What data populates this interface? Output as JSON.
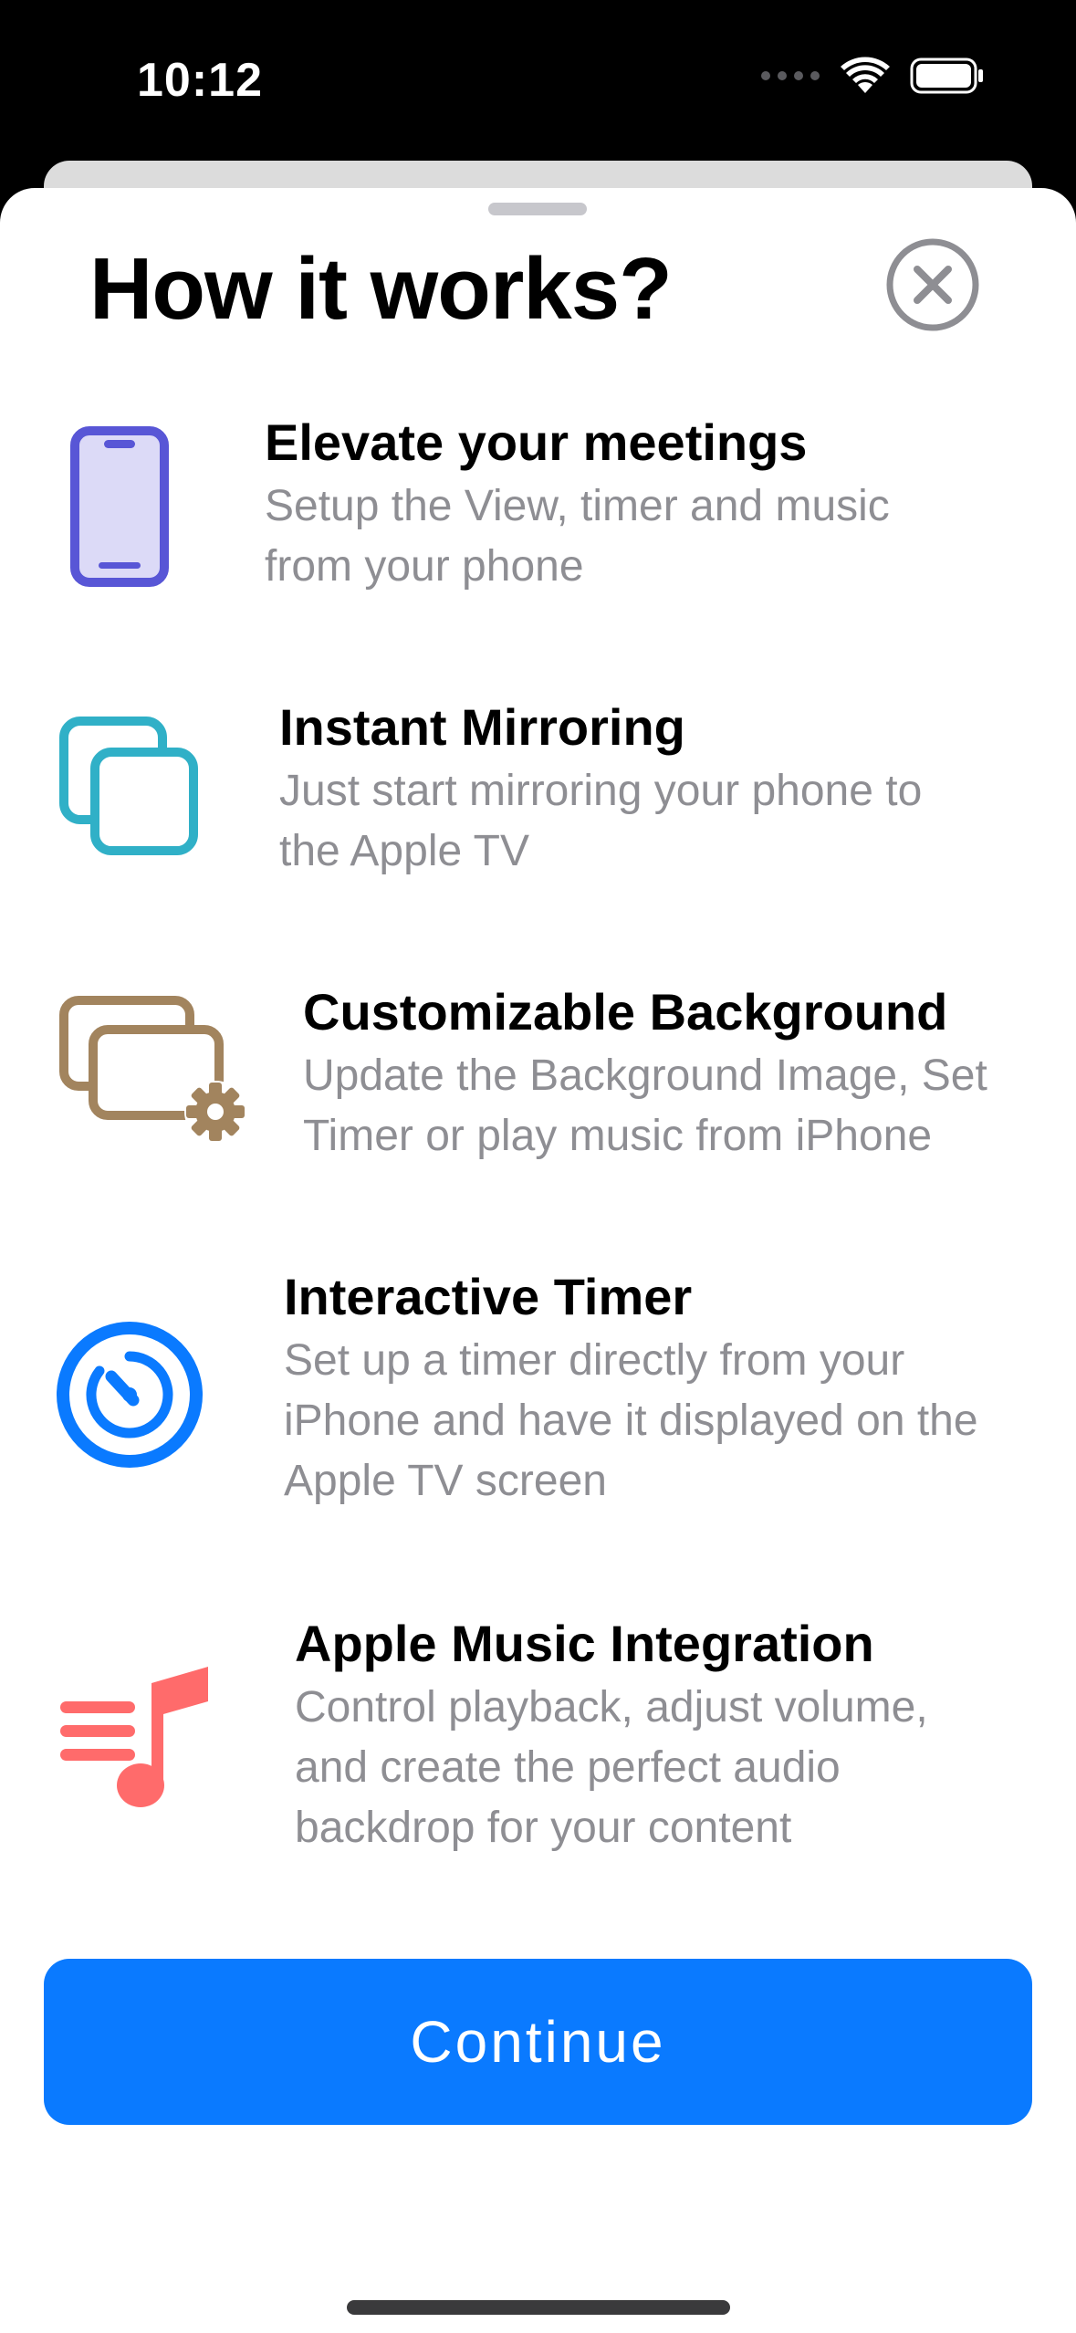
{
  "status_bar": {
    "time": "10:12",
    "icons": [
      "signal-dots-icon",
      "wifi-icon",
      "battery-icon"
    ]
  },
  "sheet": {
    "title": "How it works?",
    "close_icon": "close-circle-icon"
  },
  "features": [
    {
      "icon": "phone-icon",
      "icon_color": "#5856d6",
      "title": "Elevate your meetings",
      "desc_lines": [
        "Setup the View, timer and music",
        "from your phone"
      ]
    },
    {
      "icon": "mirroring-icon",
      "icon_color": "#30b0c7",
      "title": "Instant Mirroring",
      "desc_lines": [
        "Just start mirroring your phone to",
        "the Apple TV"
      ]
    },
    {
      "icon": "background-settings-icon",
      "icon_color": "#a2845e",
      "title": "Customizable Background",
      "desc_lines": [
        "Update the Background Image, Set",
        "Timer or play music from iPhone"
      ]
    },
    {
      "icon": "timer-icon",
      "icon_color": "#0a7aff",
      "title": "Interactive Timer",
      "desc_lines": [
        "Set up a timer directly from your",
        "iPhone and have it displayed on the",
        "Apple TV screen"
      ]
    },
    {
      "icon": "music-list-icon",
      "icon_color": "#ff6b6b",
      "title": "Apple Music Integration",
      "desc_lines": [
        "Control playback, adjust volume,",
        "and create the perfect audio",
        "backdrop for your content"
      ]
    }
  ],
  "continue_button": {
    "label": "Continue",
    "color": "#0a7aff"
  }
}
